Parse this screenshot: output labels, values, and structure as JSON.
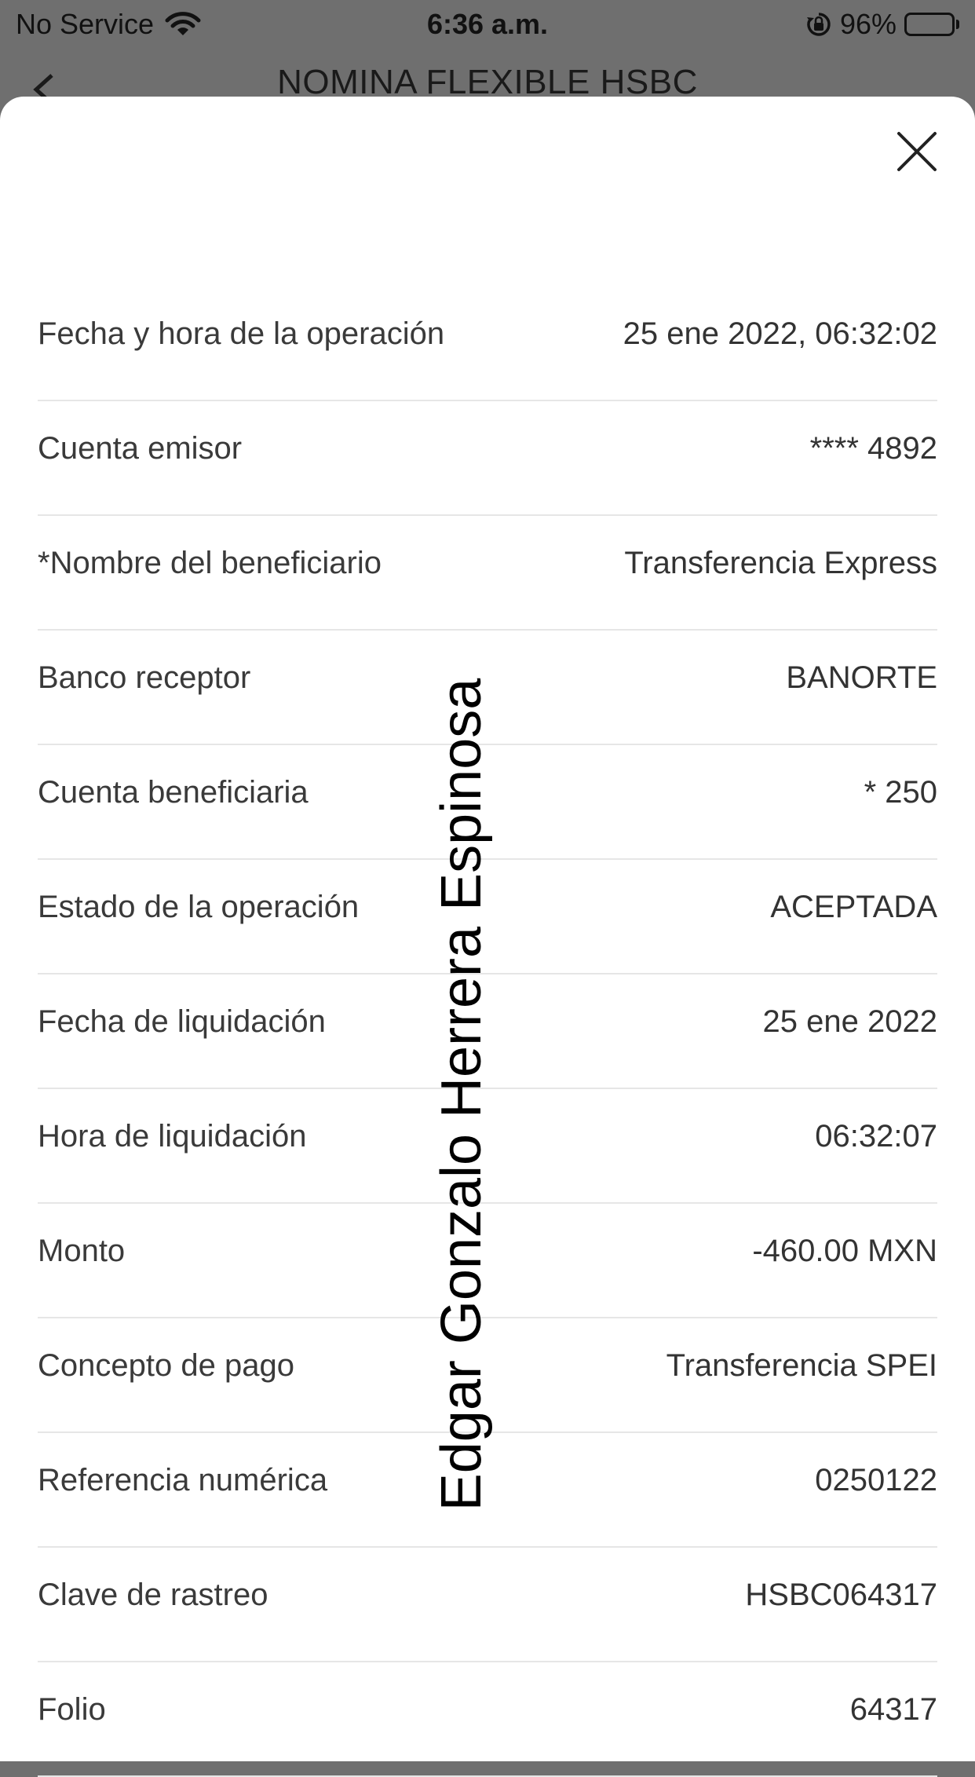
{
  "status_bar": {
    "carrier": "No Service",
    "time": "6:36 a.m.",
    "battery_text": "96%",
    "battery_level": 0.96,
    "icons": [
      "wifi-icon",
      "lock-rotation-icon",
      "battery-icon"
    ]
  },
  "nav": {
    "title": "NOMINA FLEXIBLE HSBC",
    "back_icon": "chevron-left-icon"
  },
  "sheet": {
    "close_icon": "close-icon",
    "rows": [
      {
        "label": "Fecha y hora de la operación",
        "value": "25 ene 2022, 06:32:02"
      },
      {
        "label": "Cuenta emisor",
        "value": "**** 4892"
      },
      {
        "label": "*Nombre del beneficiario",
        "value": "Transferencia Express"
      },
      {
        "label": "Banco receptor",
        "value": "BANORTE"
      },
      {
        "label": "Cuenta beneficiaria",
        "value": "* 250"
      },
      {
        "label": "Estado de la operación",
        "value": "ACEPTADA"
      },
      {
        "label": "Fecha de liquidación",
        "value": "25 ene 2022"
      },
      {
        "label": "Hora de liquidación",
        "value": "06:32:07"
      },
      {
        "label": "Monto",
        "value": "-460.00 MXN"
      },
      {
        "label": "Concepto de pago",
        "value": "Transferencia SPEI"
      },
      {
        "label": "Referencia numérica",
        "value": "0250122"
      },
      {
        "label": "Clave de rastreo",
        "value": "HSBC064317"
      },
      {
        "label": "Folio",
        "value": "64317"
      }
    ]
  },
  "watermark": "Edgar Gonzalo Herrera Espinosa"
}
